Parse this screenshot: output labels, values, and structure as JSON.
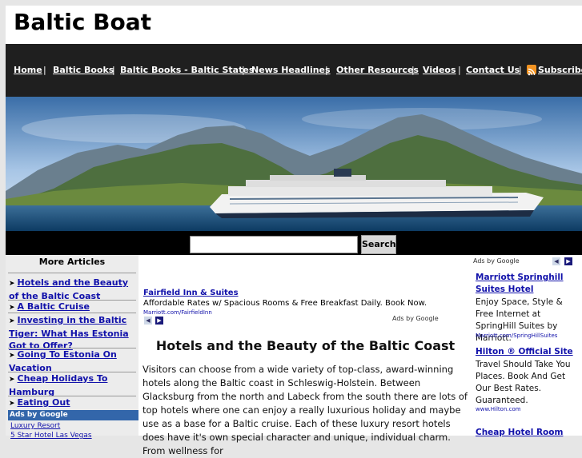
{
  "site": {
    "title": "Baltic Boat"
  },
  "nav": {
    "items": [
      "Home",
      "Baltic Books",
      "Baltic Books - Baltic States",
      "News Headlines",
      "Other Resources",
      "Videos",
      "Contact Us",
      "Subscribe"
    ],
    "separator": "|"
  },
  "search": {
    "button_label": "Search",
    "value": ""
  },
  "left_sidebar": {
    "heading": "More Articles",
    "articles": [
      "Hotels and the Beauty of the Baltic Coast",
      "A Baltic Cruise",
      "Investing in the Baltic Tiger: What Has Estonia Got to Offer?",
      "Going To Estonia On Vacation",
      "Cheap Holidays To Hamburg",
      "Eating Out"
    ],
    "ads_label": "Ads by Google",
    "ad_links": [
      "Luxury Resort",
      "5 Star Hotel Las Vegas"
    ]
  },
  "top_ad": {
    "title": "Fairfield Inn & Suites",
    "text": "Affordable Rates w/ Spacious Rooms & Free Breakfast Daily. Book Now.",
    "url": "Marriott.com/FairfieldInn",
    "ads_label": "Ads by Google"
  },
  "article": {
    "title": "Hotels and the Beauty of the Baltic Coast",
    "body": "Visitors can choose from a wide variety of top-class, award-winning hotels along the Baltic coast in Schleswig-Holstein. Between Glacksburg from the north and Labeck from the south there are lots of top hotels where one can enjoy a really luxurious holiday and maybe use as a base for a Baltic cruise. Each of these luxury resort hotels does have it's own special character and unique, individual charm. From wellness for"
  },
  "right_sidebar": {
    "ads_label": "Ads by Google",
    "ads": [
      {
        "title": "Marriott Springhill Suites Hotel",
        "text": "Enjoy Space, Style & Free Internet at SpringHill Suites by Marriott.",
        "url": "Marriott.com/SpringHillSuites"
      },
      {
        "title": "Hilton ® Official Site",
        "text": "Travel Should Take You Places. Book And Get Our Best Rates. Guaranteed.",
        "url": "www.Hilton.com"
      },
      {
        "title": "Cheap Hotel Room",
        "text": "",
        "url": ""
      }
    ]
  },
  "colors": {
    "nav_bg": "#1f1f1f",
    "link": "#1111aa",
    "ads_bar": "#3366aa"
  }
}
